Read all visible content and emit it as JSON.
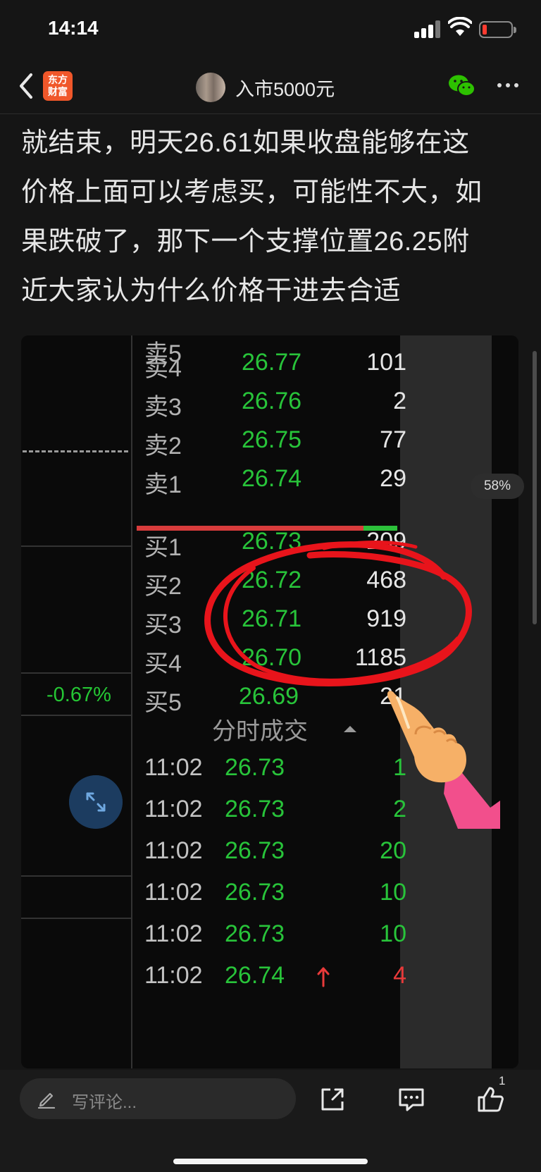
{
  "status_bar": {
    "time": "14:14",
    "battery_level": 0.1
  },
  "nav": {
    "logo_line1": "东方",
    "logo_line2": "财富",
    "title": "入市5000元"
  },
  "post": {
    "lines": [
      "就结束，明天26.61如果收盘能够在这",
      "价格上面可以考虑买，可能性不大，如",
      "果跌破了，那下一个支撑位置26.25附",
      "近大家认为什么价格干进去合适"
    ]
  },
  "chart_left": {
    "change_pct": "-0.67%"
  },
  "order_book": {
    "asks": [
      {
        "label": "卖4",
        "price": "26.77",
        "volume": "101"
      },
      {
        "label": "卖3",
        "price": "26.76",
        "volume": "2"
      },
      {
        "label": "卖2",
        "price": "26.75",
        "volume": "77"
      },
      {
        "label": "卖1",
        "price": "26.74",
        "volume": "29"
      }
    ],
    "bids": [
      {
        "label": "买1",
        "price": "26.73",
        "volume": "209"
      },
      {
        "label": "买2",
        "price": "26.72",
        "volume": "468"
      },
      {
        "label": "买3",
        "price": "26.71",
        "volume": "919"
      },
      {
        "label": "买4",
        "price": "26.70",
        "volume": "1185"
      },
      {
        "label": "买5",
        "price": "26.69",
        "volume": "21"
      }
    ],
    "buy_sell_ratio_buy_fraction": 0.13
  },
  "ticks": {
    "header": "分时成交",
    "rows": [
      {
        "time": "11:02",
        "price": "26.73",
        "volume": "1"
      },
      {
        "time": "11:02",
        "price": "26.73",
        "volume": "2"
      },
      {
        "time": "11:02",
        "price": "26.73",
        "volume": "20"
      },
      {
        "time": "11:02",
        "price": "26.73",
        "volume": "10"
      },
      {
        "time": "11:02",
        "price": "26.73",
        "volume": "10"
      },
      {
        "time": "11:02",
        "price": "26.74",
        "volume": "4"
      }
    ]
  },
  "scroll_badge": "58%",
  "bottom": {
    "comment_placeholder": "写评论...",
    "like_count": "1"
  },
  "colors": {
    "up": "#e83a3a",
    "down": "#28c43a",
    "brand": "#f0572a"
  }
}
